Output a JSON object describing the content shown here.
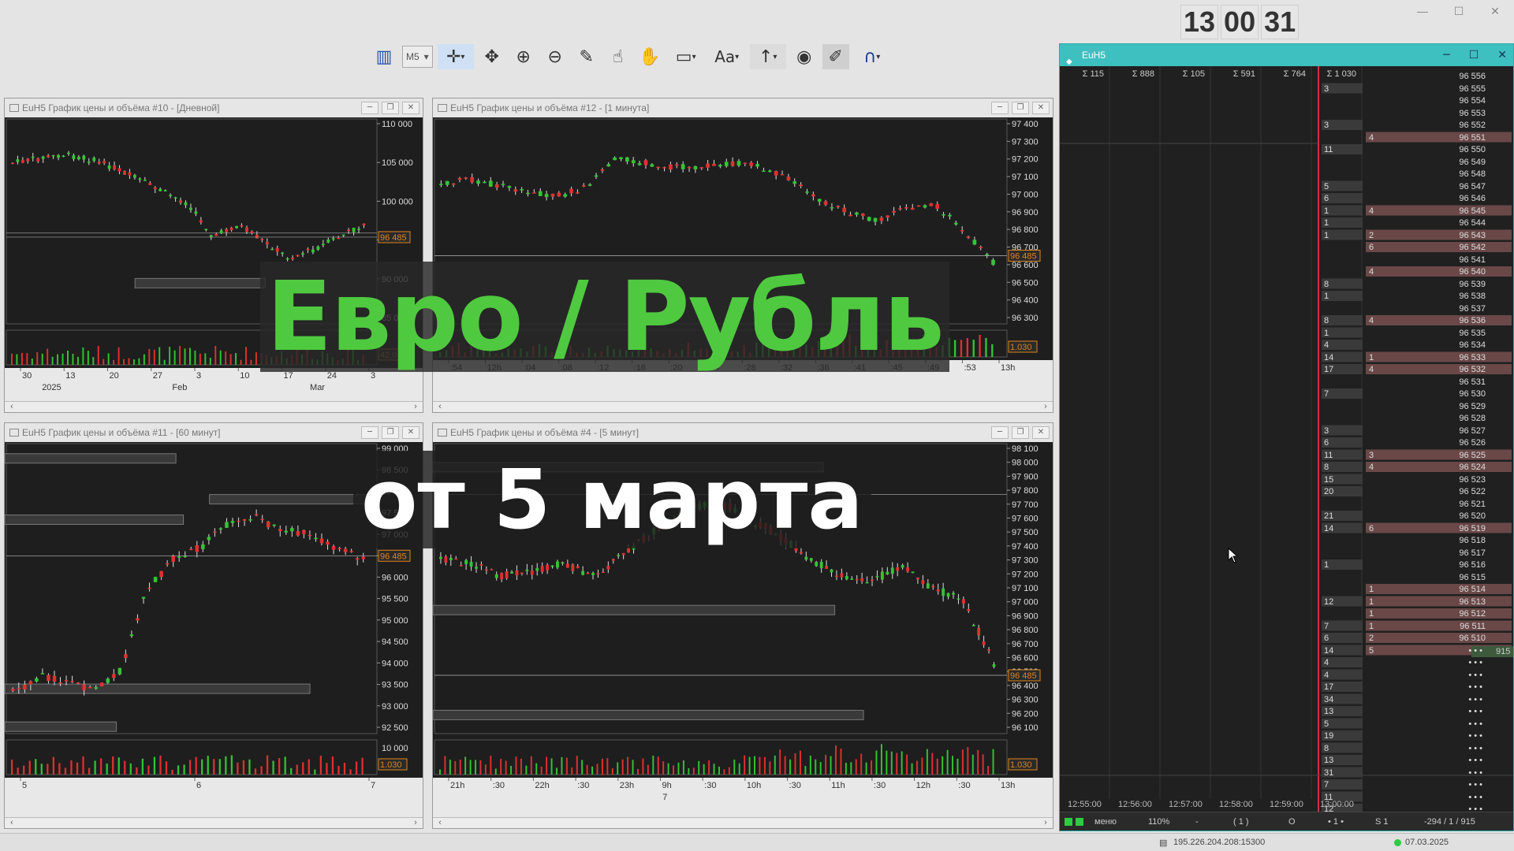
{
  "clock": {
    "h": "13",
    "m": "00",
    "s": "31"
  },
  "toolbar": {
    "timeframe": "M5"
  },
  "windows": {
    "w1": {
      "title": "EuH5 График цены и объёма #10 - [Дневной]",
      "price_tag": "96 485",
      "vol_tag": "42.0",
      "yticks": [
        "110 000",
        "105 000",
        "100 000",
        "95 000",
        "90 000",
        "85 000"
      ],
      "xticks": [
        "30",
        "13",
        "20",
        "27",
        "3",
        "10",
        "17",
        "24",
        "3"
      ],
      "xticks2": [
        "2025",
        "Feb",
        "Mar"
      ]
    },
    "w2": {
      "title": "EuH5 График цены и объёма #12 - [1 минута]",
      "price_tag": "96 485",
      "vol_tag": "1.030",
      "yticks": [
        "97 400",
        "97 300",
        "97 200",
        "97 100",
        "97 000",
        "96 900",
        "96 800",
        "96 700",
        "96 600",
        "96 500",
        "96 400",
        "96 300"
      ],
      "xticks": [
        ":54",
        "12h",
        ":04",
        ":08",
        ":12",
        ":16",
        ":20",
        ":24",
        ":28",
        ":32",
        ":36",
        ":41",
        ":45",
        ":49",
        ":53",
        "13h"
      ]
    },
    "w3": {
      "title": "EuH5 График цены и объёма #11 - [60 минут]",
      "price_tag": "96 485",
      "vol_tag": "1.030",
      "vol_top": "10 000",
      "yticks": [
        "99 000",
        "98 500",
        "98 000",
        "97 500",
        "97 000",
        "96 485",
        "96 000",
        "95 500",
        "95 000",
        "94 500",
        "94 000",
        "93 500",
        "93 000",
        "92 500"
      ],
      "xticks": [
        "5",
        "6",
        "7"
      ]
    },
    "w4": {
      "title": "EuH5 График цены и объёма #4 - [5 минут]",
      "price_tag": "96 485",
      "vol_tag": "1.030",
      "yticks": [
        "98 100",
        "98 000",
        "97 900",
        "97 800",
        "97 700",
        "97 600",
        "97 500",
        "97 400",
        "97 300",
        "97 200",
        "97 100",
        "97 000",
        "96 900",
        "96 800",
        "96 700",
        "96 600",
        "96 500",
        "96 400",
        "96 300",
        "96 200",
        "96 100"
      ],
      "xticks": [
        "21h",
        ":30",
        "22h",
        ":30",
        "23h",
        "9h",
        ":30",
        "10h",
        ":30",
        "11h",
        ":30",
        "12h",
        ":30",
        "13h"
      ],
      "xticks2": [
        "7"
      ]
    }
  },
  "overlay": {
    "line1": "Евро / Рубль",
    "line2": "от 5 марта"
  },
  "dom": {
    "title": "EuH5",
    "sums": [
      "115",
      "888",
      "105",
      "591",
      "764",
      "1 030"
    ],
    "times": [
      "12:55:00",
      "12:56:00",
      "12:57:00",
      "12:58:00",
      "12:59:00",
      "13:00:00"
    ],
    "volumes": [
      "",
      "3",
      "",
      "",
      "3",
      "",
      "11",
      "",
      "",
      "5",
      "6",
      "1",
      "1",
      "1",
      "",
      "",
      "",
      "8",
      "1",
      "",
      "8",
      "1",
      "4",
      "14",
      "17",
      "",
      "7",
      "",
      "",
      "3",
      "6",
      "11",
      "8",
      "15",
      "20",
      "",
      "21",
      "14",
      "",
      "",
      "1",
      "",
      "",
      "12",
      "",
      "7",
      "6",
      "14",
      "4",
      "4",
      "17",
      "34",
      "13",
      "5",
      "19",
      "8",
      "13",
      "31",
      "7",
      "11",
      "12"
    ],
    "bids": [
      "",
      "",
      "",
      "",
      "",
      "4",
      "",
      "",
      "",
      "",
      "",
      "4",
      "",
      "2",
      "6",
      "",
      "4",
      "",
      "",
      "",
      "4",
      "",
      "",
      "1",
      "4",
      "",
      "",
      "",
      "",
      "",
      "",
      "3",
      "4",
      "",
      "",
      "",
      "",
      "6",
      "",
      "",
      "",
      "",
      "1",
      "1",
      "1",
      "1",
      "2",
      "5"
    ],
    "prices": [
      "96 556",
      "96 555",
      "96 554",
      "96 553",
      "96 552",
      "96 551",
      "96 550",
      "96 549",
      "96 548",
      "96 547",
      "96 546",
      "96 545",
      "96 544",
      "96 543",
      "96 542",
      "96 541",
      "96 540",
      "96 539",
      "96 538",
      "96 537",
      "96 536",
      "96 535",
      "96 534",
      "96 533",
      "96 532",
      "96 531",
      "96 530",
      "96 529",
      "96 528",
      "96 527",
      "96 526",
      "96 525",
      "96 524",
      "96 523",
      "96 522",
      "96 521",
      "96 520",
      "96 519",
      "96 518",
      "96 517",
      "96 516",
      "96 515",
      "96 514",
      "96 513",
      "96 512",
      "96 511",
      "96 510"
    ],
    "side_value": "915",
    "status": {
      "menu": "меню",
      "zoom": "110%",
      "dash": "-",
      "paren": "( 1 )",
      "circle": "O",
      "dots": "• 1 •",
      "s": "S 1",
      "pos": "-294  /  1  /  915"
    }
  },
  "status": {
    "server": "195.226.204.208:15300",
    "date": "07.03.2025"
  }
}
